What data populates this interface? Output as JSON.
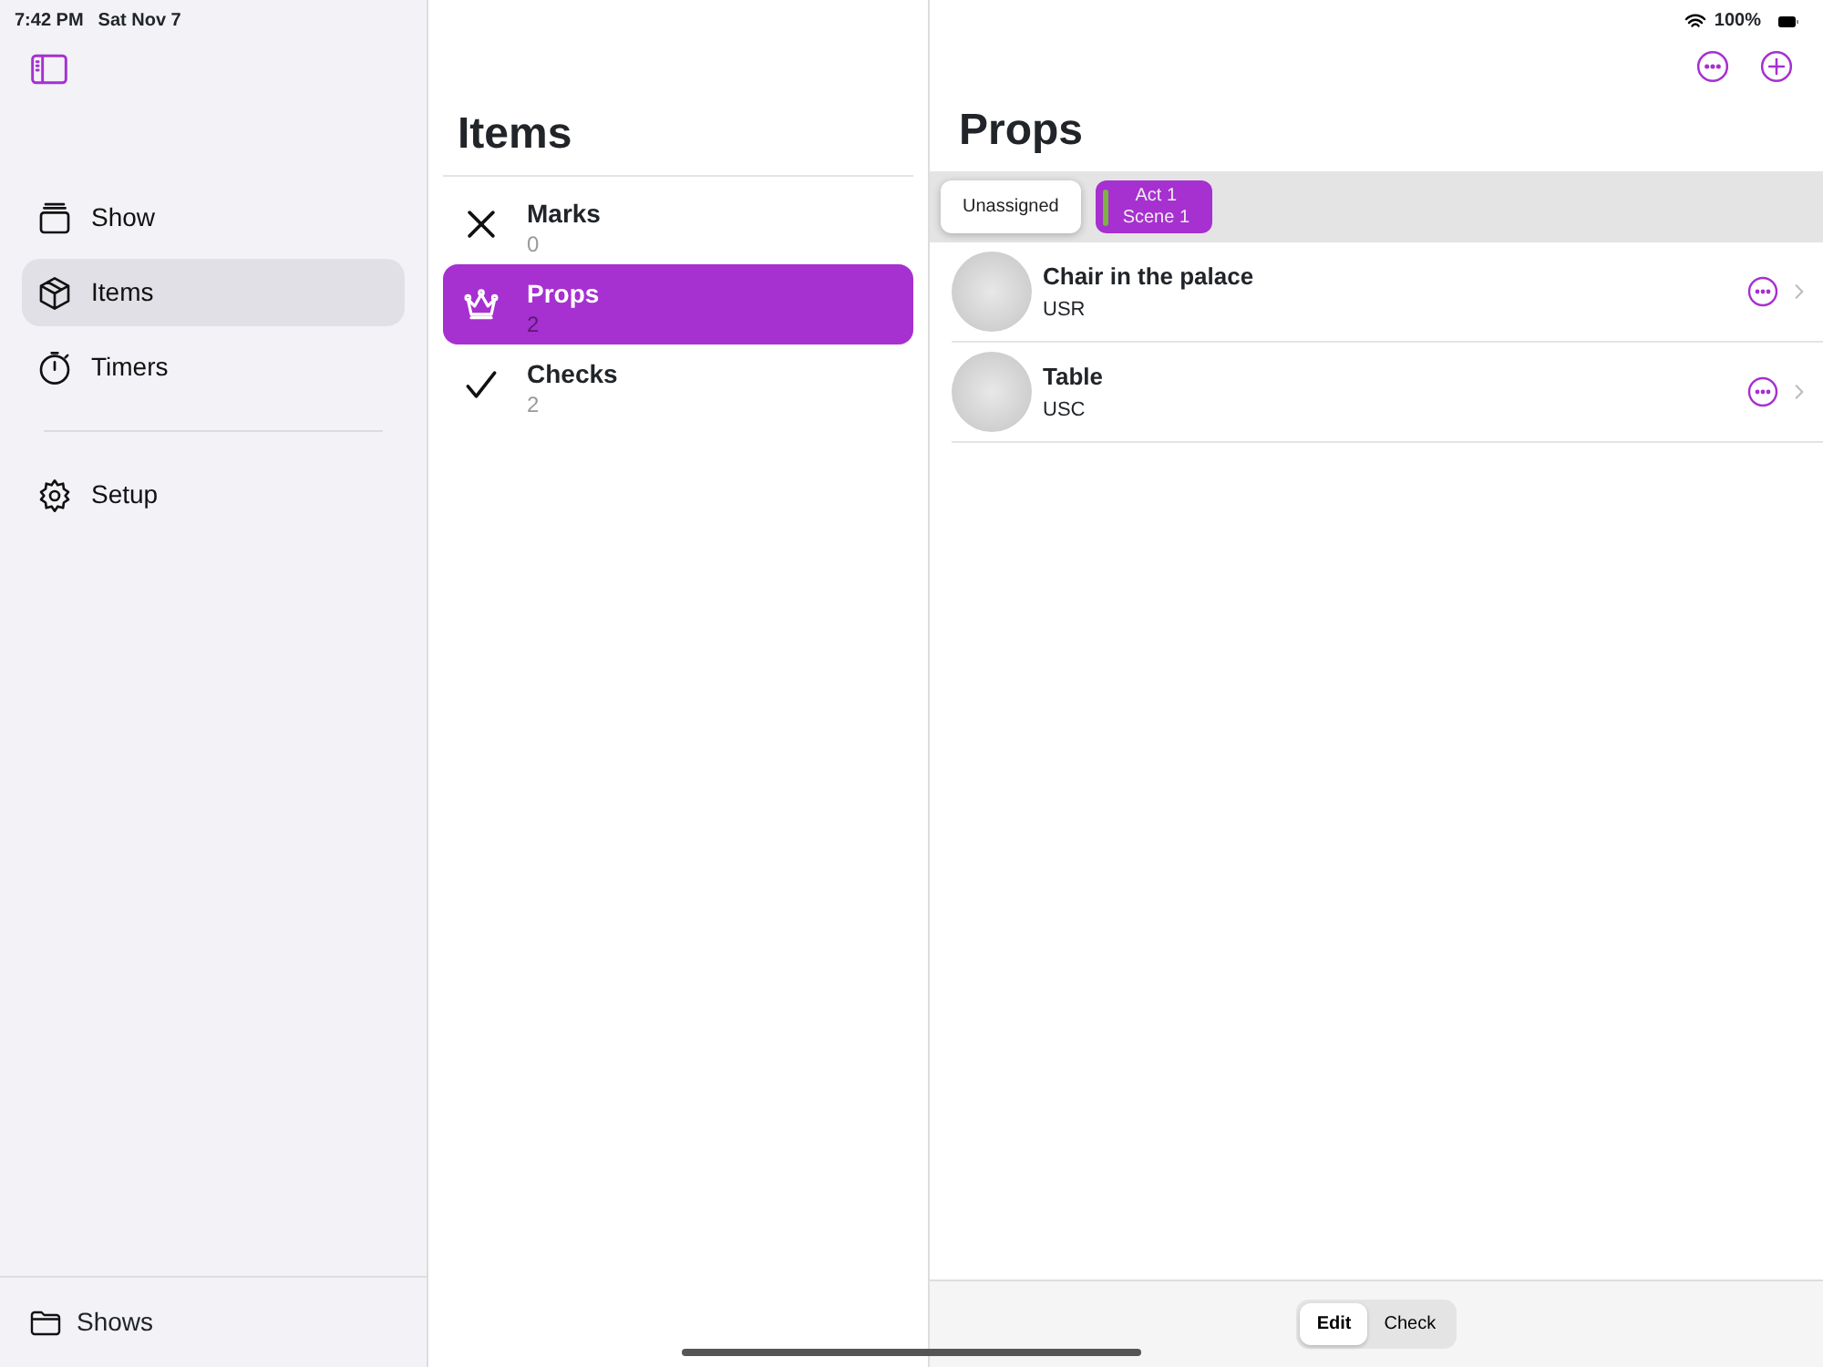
{
  "status_bar": {
    "time": "7:42 PM",
    "date": "Sat Nov 7",
    "battery": "100%"
  },
  "sidebar": {
    "items": [
      {
        "kind": "show",
        "label": "Show",
        "selected": false
      },
      {
        "kind": "items",
        "label": "Items",
        "selected": true
      },
      {
        "kind": "timers",
        "label": "Timers",
        "selected": false
      }
    ],
    "setup": {
      "label": "Setup"
    },
    "footer": {
      "label": "Shows"
    }
  },
  "list": {
    "title": "Items",
    "categories": [
      {
        "kind": "marks",
        "label": "Marks",
        "count": "0",
        "selected": false
      },
      {
        "kind": "props",
        "label": "Props",
        "count": "2",
        "selected": true
      },
      {
        "kind": "checks",
        "label": "Checks",
        "count": "2",
        "selected": false
      }
    ]
  },
  "detail": {
    "title": "Props",
    "filters": [
      {
        "lines": [
          "Unassigned"
        ],
        "selected": true
      },
      {
        "lines": [
          "Act 1",
          "Scene 1"
        ],
        "selected": false,
        "color": "#7cb342"
      }
    ],
    "rows": [
      {
        "name": "Chair in the palace",
        "code": "USR"
      },
      {
        "name": "Table",
        "code": "USC"
      }
    ],
    "modes": [
      {
        "label": "Edit",
        "selected": true
      },
      {
        "label": "Check",
        "selected": false
      }
    ]
  }
}
